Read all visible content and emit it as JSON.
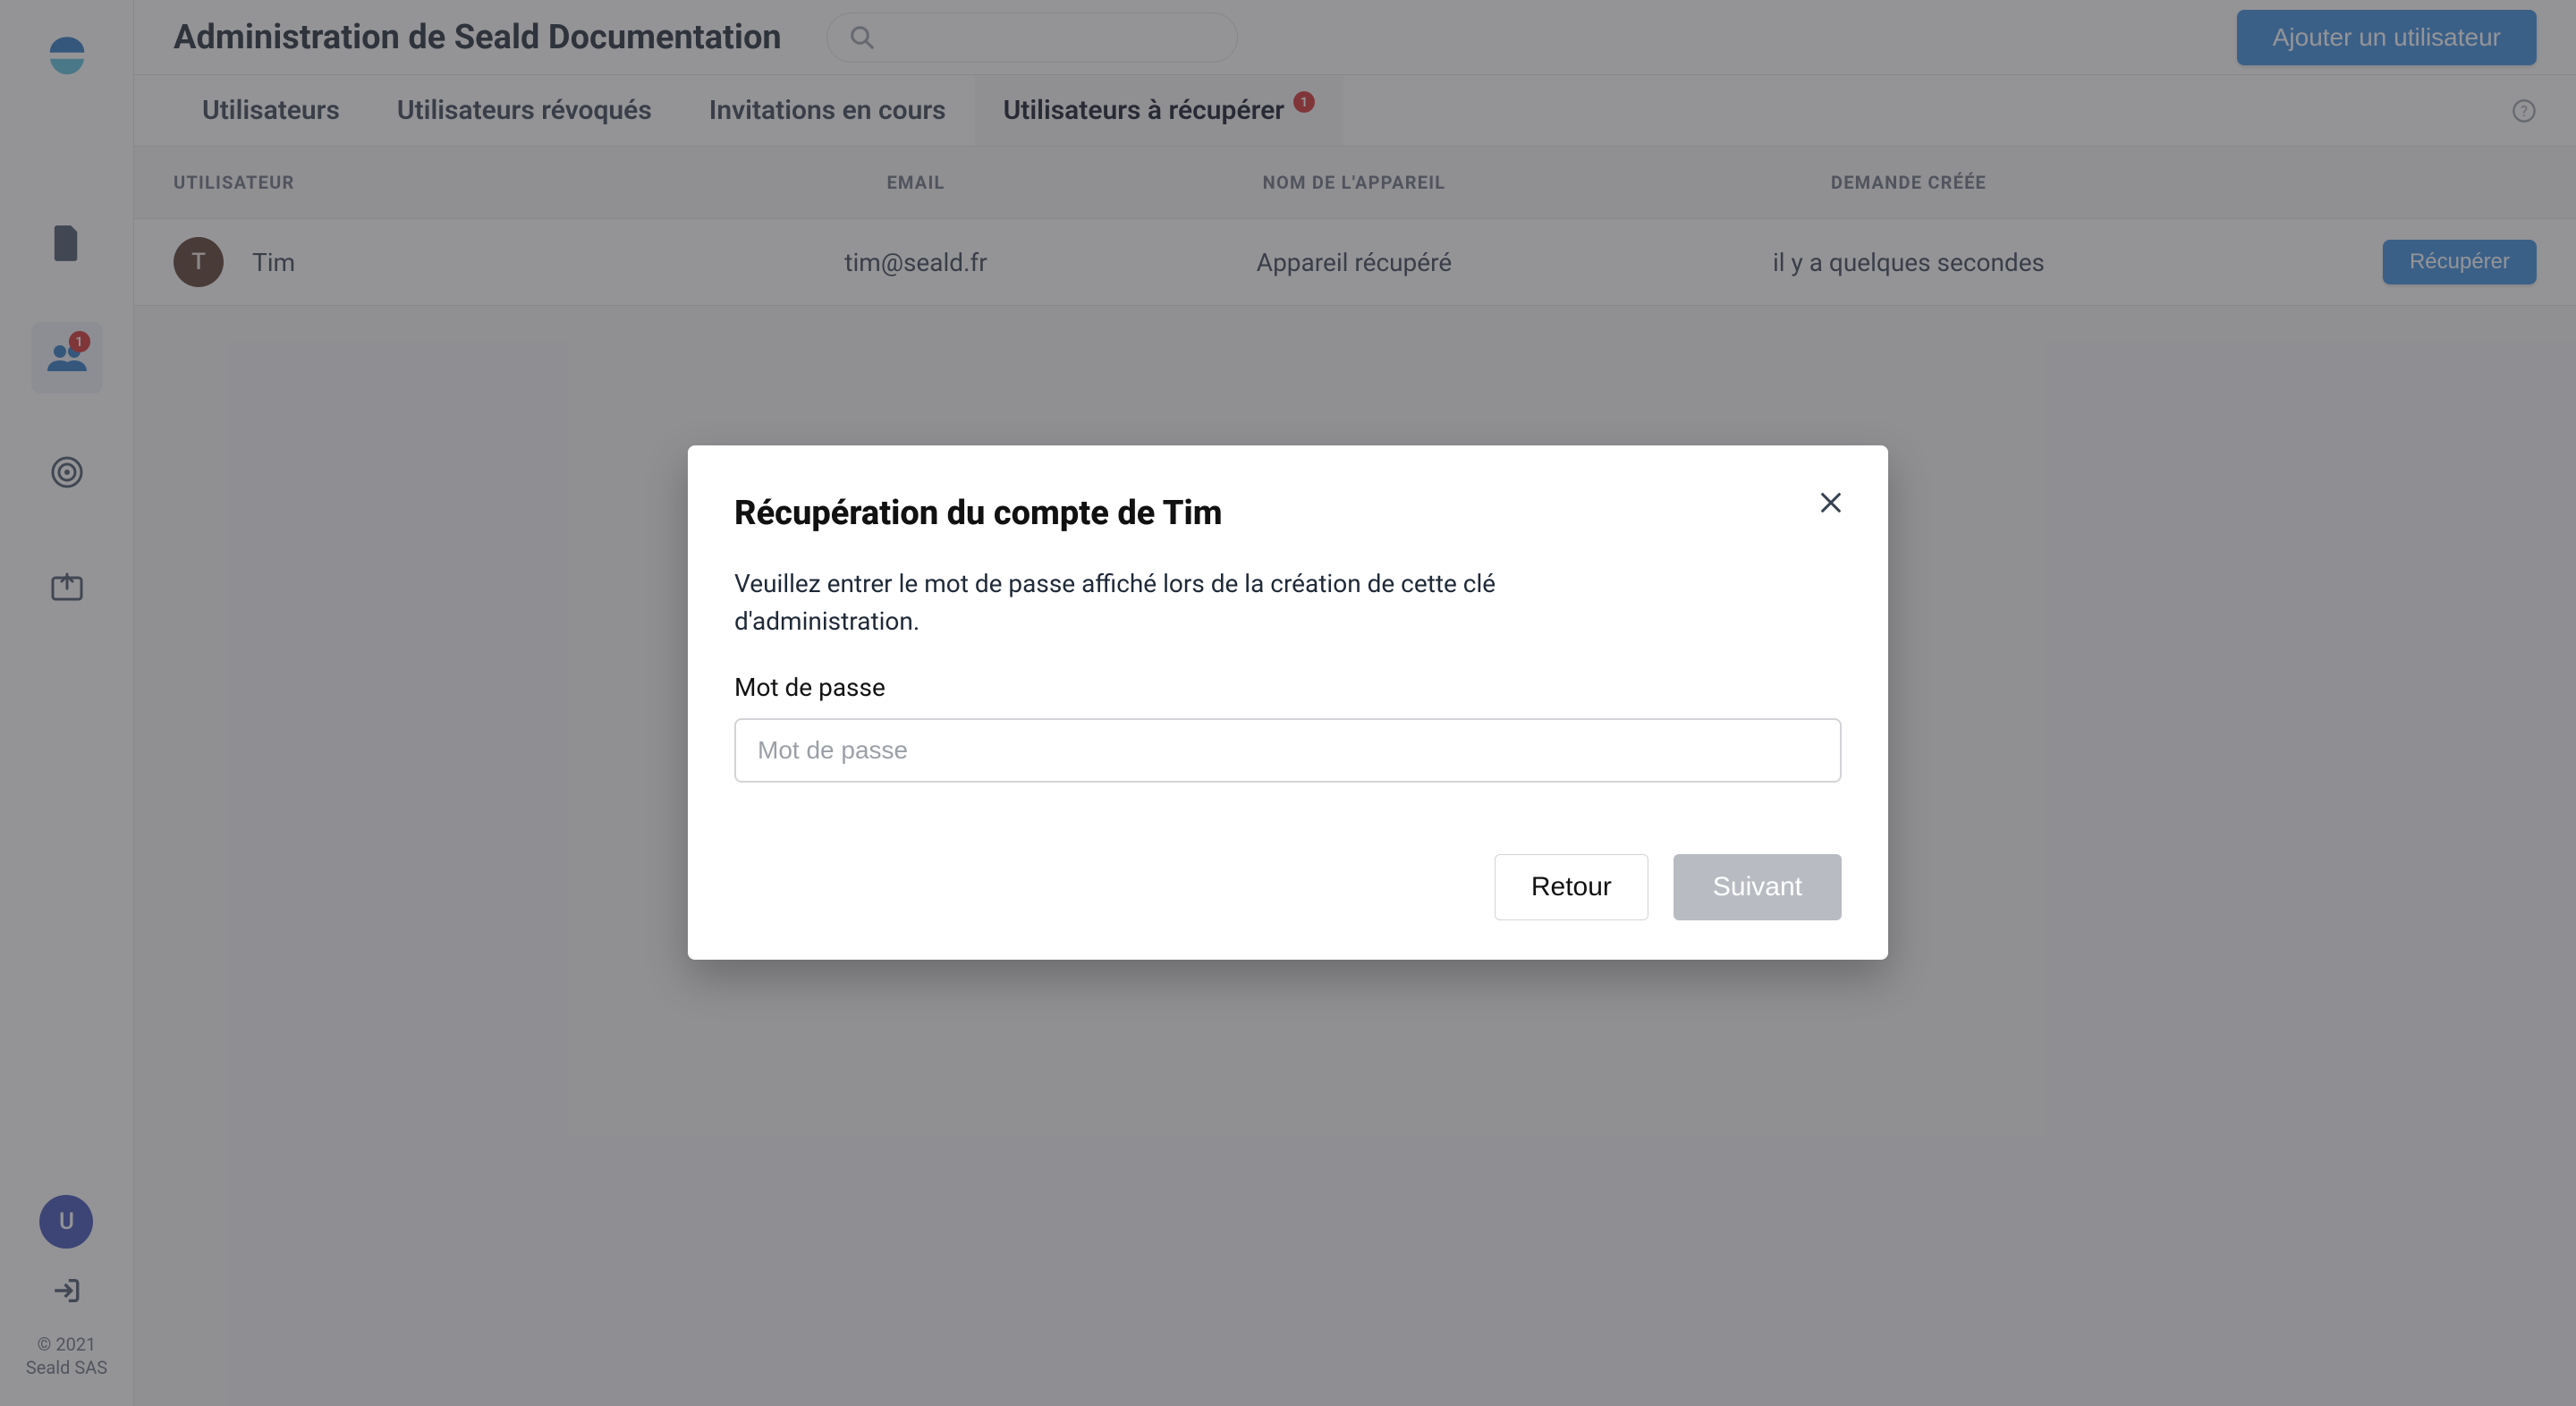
{
  "header": {
    "title": "Administration de Seald Documentation",
    "add_user_label": "Ajouter un utilisateur"
  },
  "sidebar": {
    "badge_count": "1",
    "avatar_letter": "U",
    "copyright_line1": "© 2021",
    "copyright_line2": "Seald SAS"
  },
  "tabs": {
    "users": "Utilisateurs",
    "revoked": "Utilisateurs révoqués",
    "invitations": "Invitations en cours",
    "recover": "Utilisateurs à récupérer",
    "recover_badge": "1"
  },
  "table": {
    "headers": {
      "user": "Utilisateur",
      "email": "Email",
      "device": "Nom de l'appareil",
      "created": "Demande créée"
    },
    "row": {
      "avatar_letter": "T",
      "name": "Tim",
      "email": "tim@seald.fr",
      "device": "Appareil récupéré",
      "created": "il y a quelques secondes",
      "action": "Récupérer"
    }
  },
  "modal": {
    "title": "Récupération du compte de Tim",
    "description": "Veuillez entrer le mot de passe affiché lors de la création de cette clé d'administration.",
    "password_label": "Mot de passe",
    "password_placeholder": "Mot de passe",
    "back": "Retour",
    "next": "Suivant"
  }
}
